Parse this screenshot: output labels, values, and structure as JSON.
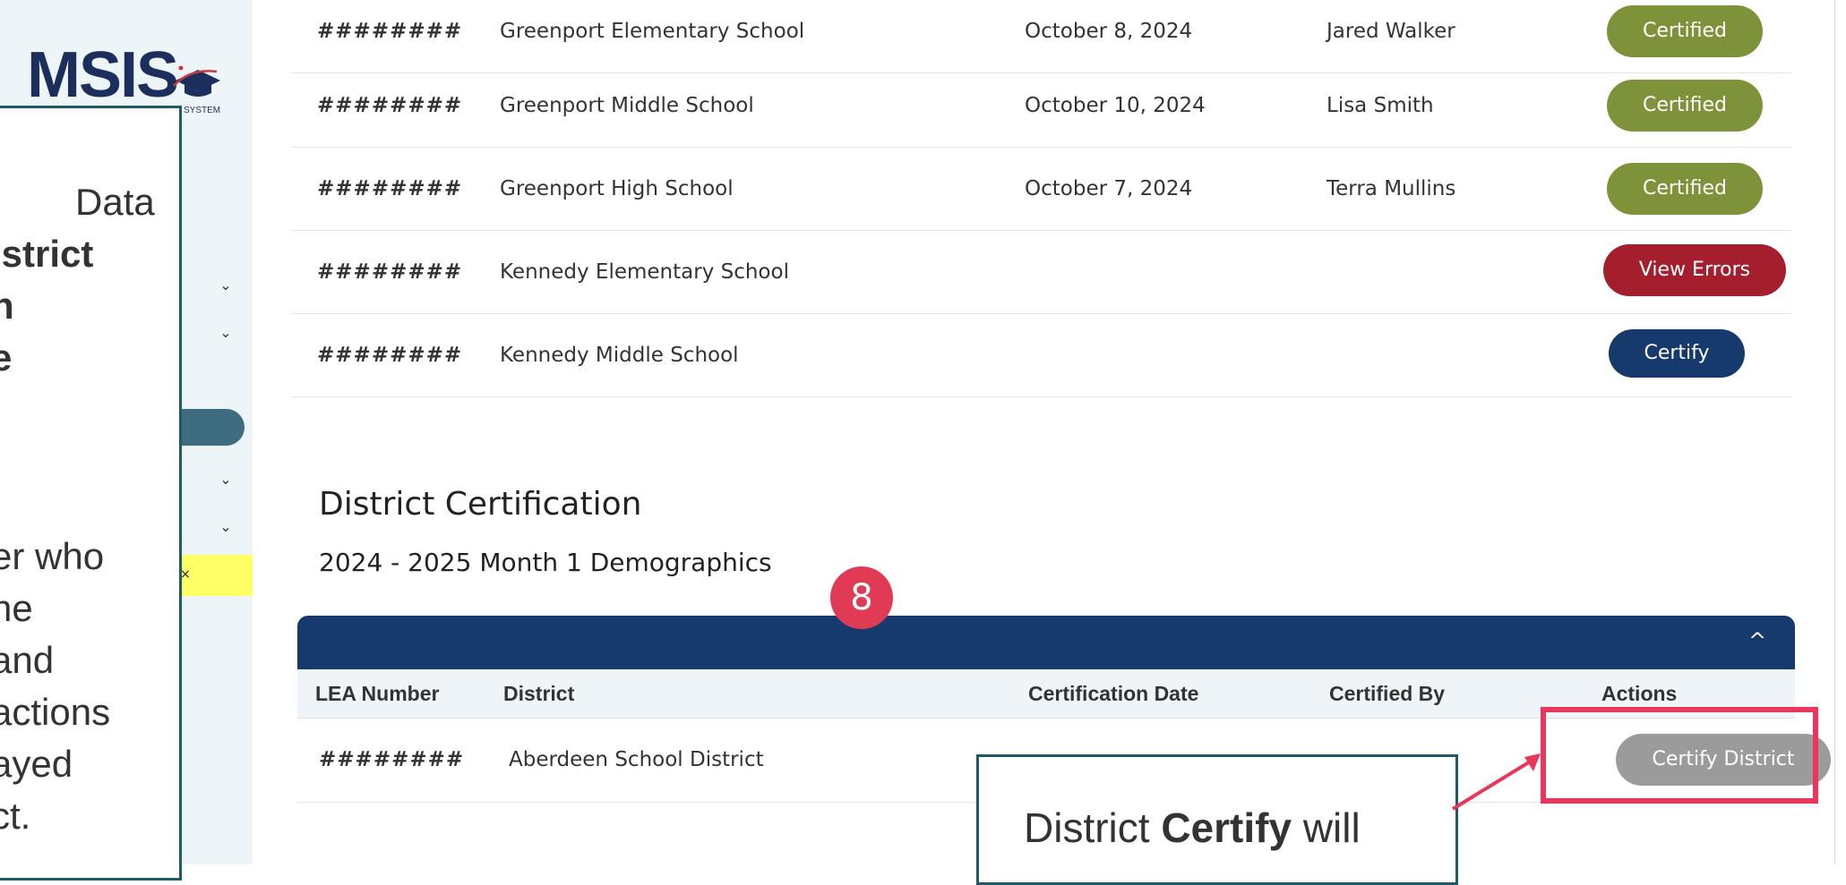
{
  "sidebar": {
    "logo_text": "MSIS",
    "logo_subtext": "SYSTEM",
    "chevrons": [
      "⌄",
      "⌄",
      "⌄",
      "⌄"
    ],
    "close_glyph": "×"
  },
  "note_left": {
    "lines": [
      {
        "pre": "",
        "text": "Data",
        "bold": ""
      },
      {
        "pre": "",
        "text": "",
        "bold": "istrict"
      },
      {
        "pre": "",
        "text": "",
        "bold": "n"
      },
      {
        "pre": "",
        "text": "",
        "bold": "e"
      },
      {
        "pre": "",
        "text": "er who",
        "bold": ""
      },
      {
        "pre": "",
        "text": "ne",
        "bold": ""
      },
      {
        "pre": "",
        "text": " and",
        "bold": ""
      },
      {
        "pre": "",
        "text": "actions",
        "bold": ""
      },
      {
        "pre": "",
        "text": "ayed",
        "bold": ""
      },
      {
        "pre": "",
        "text": "ct.",
        "bold": ""
      }
    ]
  },
  "schools": {
    "rows": [
      {
        "lea": "########",
        "name": "Greenport Elementary School",
        "date": "October 8, 2024",
        "by": "Jared Walker",
        "action": "Certified",
        "kind": "certified"
      },
      {
        "lea": "########",
        "name": "Greenport Middle School",
        "date": "October 10, 2024",
        "by": "Lisa Smith",
        "action": "Certified",
        "kind": "certified"
      },
      {
        "lea": "########",
        "name": "Greenport High School",
        "date": "October 7, 2024",
        "by": "Terra Mullins",
        "action": "Certified",
        "kind": "certified"
      },
      {
        "lea": "########",
        "name": "Kennedy Elementary School",
        "date": "",
        "by": "",
        "action": "View Errors",
        "kind": "errors"
      },
      {
        "lea": "########",
        "name": "Kennedy Middle School",
        "date": "",
        "by": "",
        "action": "Certify",
        "kind": "certify"
      }
    ]
  },
  "district": {
    "title": "District Certification",
    "subtitle": "2024 - 2025 Month 1 Demographics",
    "collapse_glyph": "^",
    "headers": {
      "lea": "LEA Number",
      "district": "District",
      "date": "Certification Date",
      "by": "Certified By",
      "actions": "Actions"
    },
    "row": {
      "lea": "########",
      "district": "Aberdeen School District",
      "action": "Certify District"
    }
  },
  "callout": {
    "step_number": "8",
    "text_prefix": "District ",
    "text_bold": "Certify",
    "text_suffix": " will"
  },
  "colors": {
    "certified": "#7e9339",
    "errors": "#a51e2d",
    "certify": "#153a6b",
    "disabled": "#9b9b9b",
    "accent": "#e8375b",
    "navy": "#173a6d"
  }
}
